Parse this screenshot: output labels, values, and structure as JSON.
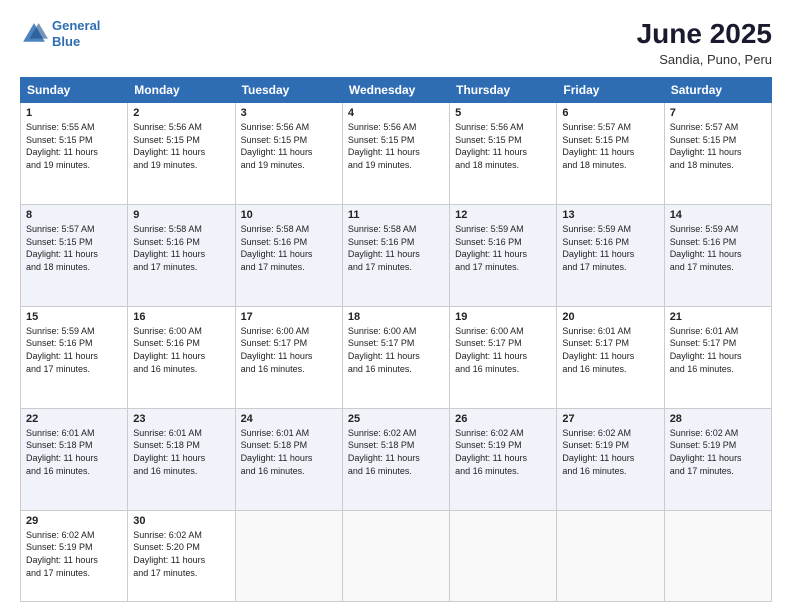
{
  "logo": {
    "line1": "General",
    "line2": "Blue"
  },
  "title": "June 2025",
  "location": "Sandia, Puno, Peru",
  "days_header": [
    "Sunday",
    "Monday",
    "Tuesday",
    "Wednesday",
    "Thursday",
    "Friday",
    "Saturday"
  ],
  "weeks": [
    [
      {
        "day": "1",
        "info": "Sunrise: 5:55 AM\nSunset: 5:15 PM\nDaylight: 11 hours\nand 19 minutes."
      },
      {
        "day": "2",
        "info": "Sunrise: 5:56 AM\nSunset: 5:15 PM\nDaylight: 11 hours\nand 19 minutes."
      },
      {
        "day": "3",
        "info": "Sunrise: 5:56 AM\nSunset: 5:15 PM\nDaylight: 11 hours\nand 19 minutes."
      },
      {
        "day": "4",
        "info": "Sunrise: 5:56 AM\nSunset: 5:15 PM\nDaylight: 11 hours\nand 19 minutes."
      },
      {
        "day": "5",
        "info": "Sunrise: 5:56 AM\nSunset: 5:15 PM\nDaylight: 11 hours\nand 18 minutes."
      },
      {
        "day": "6",
        "info": "Sunrise: 5:57 AM\nSunset: 5:15 PM\nDaylight: 11 hours\nand 18 minutes."
      },
      {
        "day": "7",
        "info": "Sunrise: 5:57 AM\nSunset: 5:15 PM\nDaylight: 11 hours\nand 18 minutes."
      }
    ],
    [
      {
        "day": "8",
        "info": "Sunrise: 5:57 AM\nSunset: 5:15 PM\nDaylight: 11 hours\nand 18 minutes."
      },
      {
        "day": "9",
        "info": "Sunrise: 5:58 AM\nSunset: 5:16 PM\nDaylight: 11 hours\nand 17 minutes."
      },
      {
        "day": "10",
        "info": "Sunrise: 5:58 AM\nSunset: 5:16 PM\nDaylight: 11 hours\nand 17 minutes."
      },
      {
        "day": "11",
        "info": "Sunrise: 5:58 AM\nSunset: 5:16 PM\nDaylight: 11 hours\nand 17 minutes."
      },
      {
        "day": "12",
        "info": "Sunrise: 5:59 AM\nSunset: 5:16 PM\nDaylight: 11 hours\nand 17 minutes."
      },
      {
        "day": "13",
        "info": "Sunrise: 5:59 AM\nSunset: 5:16 PM\nDaylight: 11 hours\nand 17 minutes."
      },
      {
        "day": "14",
        "info": "Sunrise: 5:59 AM\nSunset: 5:16 PM\nDaylight: 11 hours\nand 17 minutes."
      }
    ],
    [
      {
        "day": "15",
        "info": "Sunrise: 5:59 AM\nSunset: 5:16 PM\nDaylight: 11 hours\nand 17 minutes."
      },
      {
        "day": "16",
        "info": "Sunrise: 6:00 AM\nSunset: 5:16 PM\nDaylight: 11 hours\nand 16 minutes."
      },
      {
        "day": "17",
        "info": "Sunrise: 6:00 AM\nSunset: 5:17 PM\nDaylight: 11 hours\nand 16 minutes."
      },
      {
        "day": "18",
        "info": "Sunrise: 6:00 AM\nSunset: 5:17 PM\nDaylight: 11 hours\nand 16 minutes."
      },
      {
        "day": "19",
        "info": "Sunrise: 6:00 AM\nSunset: 5:17 PM\nDaylight: 11 hours\nand 16 minutes."
      },
      {
        "day": "20",
        "info": "Sunrise: 6:01 AM\nSunset: 5:17 PM\nDaylight: 11 hours\nand 16 minutes."
      },
      {
        "day": "21",
        "info": "Sunrise: 6:01 AM\nSunset: 5:17 PM\nDaylight: 11 hours\nand 16 minutes."
      }
    ],
    [
      {
        "day": "22",
        "info": "Sunrise: 6:01 AM\nSunset: 5:18 PM\nDaylight: 11 hours\nand 16 minutes."
      },
      {
        "day": "23",
        "info": "Sunrise: 6:01 AM\nSunset: 5:18 PM\nDaylight: 11 hours\nand 16 minutes."
      },
      {
        "day": "24",
        "info": "Sunrise: 6:01 AM\nSunset: 5:18 PM\nDaylight: 11 hours\nand 16 minutes."
      },
      {
        "day": "25",
        "info": "Sunrise: 6:02 AM\nSunset: 5:18 PM\nDaylight: 11 hours\nand 16 minutes."
      },
      {
        "day": "26",
        "info": "Sunrise: 6:02 AM\nSunset: 5:19 PM\nDaylight: 11 hours\nand 16 minutes."
      },
      {
        "day": "27",
        "info": "Sunrise: 6:02 AM\nSunset: 5:19 PM\nDaylight: 11 hours\nand 16 minutes."
      },
      {
        "day": "28",
        "info": "Sunrise: 6:02 AM\nSunset: 5:19 PM\nDaylight: 11 hours\nand 17 minutes."
      }
    ],
    [
      {
        "day": "29",
        "info": "Sunrise: 6:02 AM\nSunset: 5:19 PM\nDaylight: 11 hours\nand 17 minutes."
      },
      {
        "day": "30",
        "info": "Sunrise: 6:02 AM\nSunset: 5:20 PM\nDaylight: 11 hours\nand 17 minutes."
      },
      null,
      null,
      null,
      null,
      null
    ]
  ]
}
